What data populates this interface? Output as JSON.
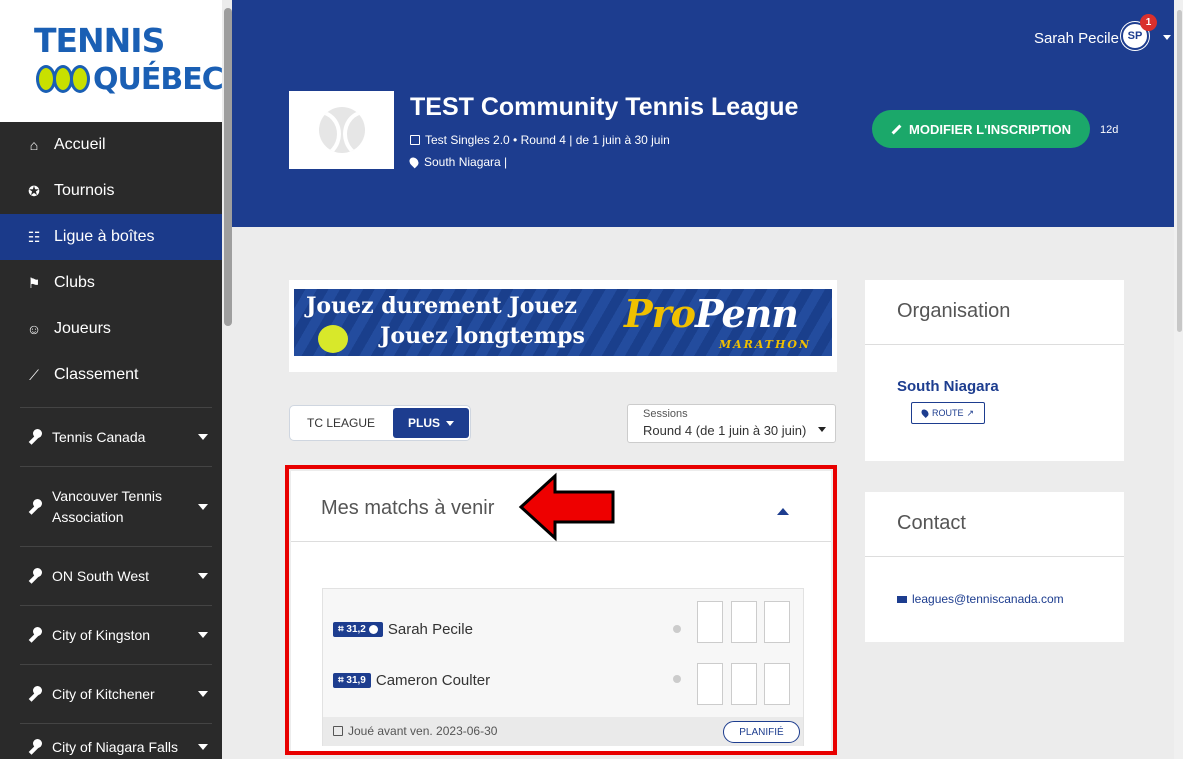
{
  "sidebar": {
    "logo_line1": "TENNIS",
    "logo_line2": "QUÉBEC",
    "nav": [
      {
        "label": "Accueil",
        "icon": "home-icon"
      },
      {
        "label": "Tournois",
        "icon": "medal-icon"
      },
      {
        "label": "Ligue à boîtes",
        "icon": "ladder-icon"
      },
      {
        "label": "Clubs",
        "icon": "flag-icon"
      },
      {
        "label": "Joueurs",
        "icon": "users-icon"
      },
      {
        "label": "Classement",
        "icon": "chart-icon"
      }
    ],
    "active_index": 2,
    "orgs": [
      {
        "label": "Tennis Canada"
      },
      {
        "label": "Vancouver Tennis Association"
      },
      {
        "label": "ON South West"
      },
      {
        "label": "City of Kingston"
      },
      {
        "label": "City of Kitchener"
      },
      {
        "label": "City of Niagara Falls"
      }
    ]
  },
  "header": {
    "user_name": "Sarah Pecile",
    "avatar_initials": "SP",
    "notification_count": "1",
    "league_title": "TEST Community Tennis League",
    "league_meta": "Test Singles 2.0 • Round 4 | de 1 juin à 30 juin",
    "league_location": "South Niagara |",
    "edit_button": "MODIFIER L'INSCRIPTION",
    "days_left": "12d"
  },
  "banner": {
    "line1": "Jouez durement  Jouez",
    "line2": "Jouez longtemps",
    "brand_pro": "Pro",
    "brand_name": "Penn",
    "brand_sub": "MARATHON"
  },
  "tabs": {
    "tc_league": "TC LEAGUE",
    "plus": "PLUS"
  },
  "sessions": {
    "label": "Sessions",
    "value": "Round 4 (de 1 juin à 30 juin)"
  },
  "matches": {
    "title": "Mes matchs à venir",
    "players": [
      {
        "rating": "⌗ 31,2",
        "name": "Sarah Pecile",
        "verified": true
      },
      {
        "rating": "⌗ 31,9",
        "name": "Cameron Coulter",
        "verified": false
      }
    ],
    "footer_date": "Joué avant ven. 2023-06-30",
    "plan_button": "PLANIFIÉ"
  },
  "organisation": {
    "title": "Organisation",
    "name": "South Niagara",
    "route_button": "ROUTE"
  },
  "contact": {
    "title": "Contact",
    "email": "leagues@tenniscanada.com"
  },
  "colors": {
    "brand_blue": "#1d3d8f",
    "sidebar_bg": "#2a2a2a",
    "accent_green": "#1ba86a",
    "highlight_red": "#e80000"
  }
}
